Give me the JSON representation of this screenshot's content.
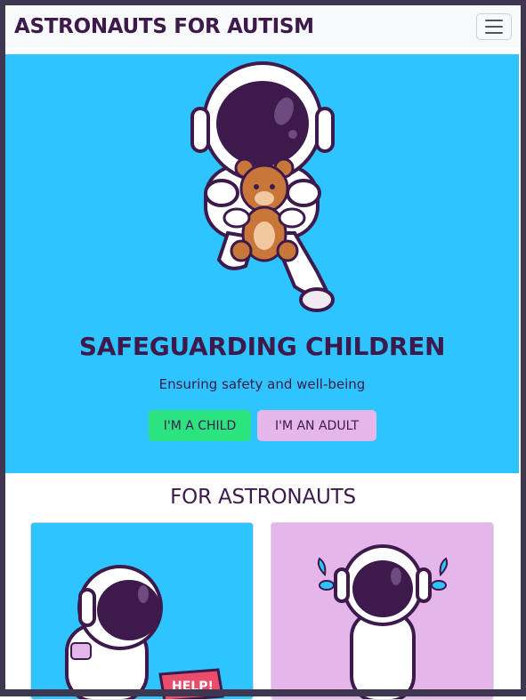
{
  "navbar": {
    "brand": "ASTRONAUTS FOR AUTISM",
    "toggler_icon": "hamburger-icon"
  },
  "hero": {
    "title": "SAFEGUARDING CHILDREN",
    "subtitle": "Ensuring safety and well-being",
    "child_button": "I'M A CHILD",
    "adult_button": "I'M AN ADULT",
    "background_color": "#2ec4ff"
  },
  "section": {
    "title": "FOR ASTRONAUTS"
  },
  "cards": [
    {
      "illustration": "sad-astronaut-help-sign",
      "sign_text": "HELP!",
      "background_color": "#2ec4ff"
    },
    {
      "illustration": "crying-astronaut",
      "background_color": "#e4b6ea"
    }
  ],
  "colors": {
    "brand_text": "#3d1a4b",
    "child_button": "#2be47f",
    "adult_button": "#e4b6ea"
  }
}
